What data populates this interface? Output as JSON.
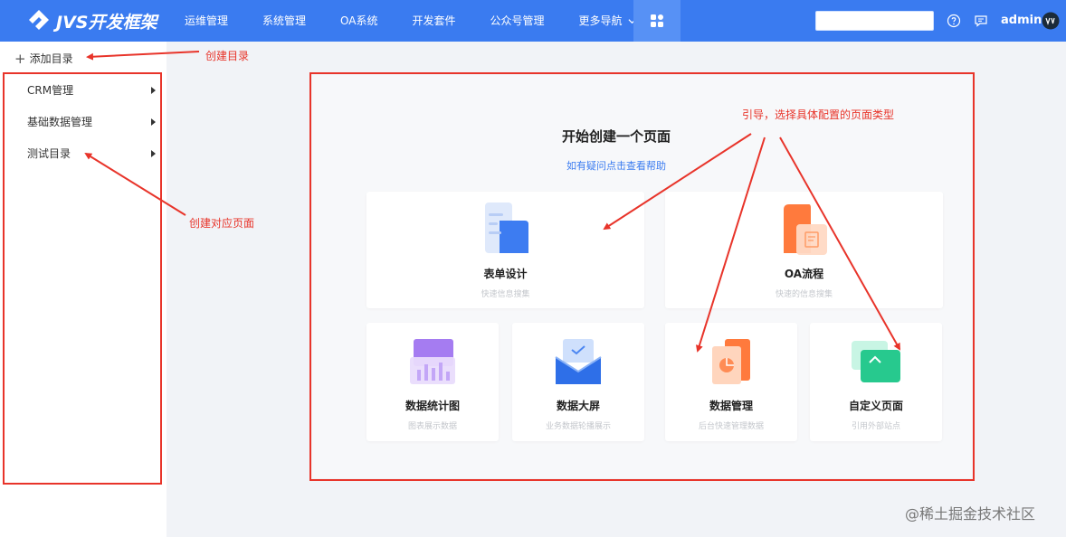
{
  "app": {
    "logo_text": "JVS开发框架"
  },
  "nav": {
    "items": [
      {
        "label": "运维管理"
      },
      {
        "label": "系统管理"
      },
      {
        "label": "OA系统"
      },
      {
        "label": "开发套件"
      },
      {
        "label": "公众号管理"
      },
      {
        "label": "更多导航"
      }
    ],
    "apps_icon": "grid-apps-icon"
  },
  "header": {
    "search_placeholder": "",
    "username": "admin"
  },
  "sidebar": {
    "add_label": "添加目录",
    "items": [
      {
        "label": "CRM管理"
      },
      {
        "label": "基础数据管理"
      },
      {
        "label": "测试目录"
      }
    ]
  },
  "main": {
    "title": "开始创建一个页面",
    "help_link": "如有疑问点击查看帮助",
    "tiles": [
      {
        "name": "表单设计",
        "desc": "快速信息搜集",
        "icon": "form-design-icon"
      },
      {
        "name": "OA流程",
        "desc": "快速的信息搜集",
        "icon": "oa-flow-icon"
      },
      {
        "name": "数据统计图",
        "desc": "图表展示数据",
        "icon": "chart-stat-icon"
      },
      {
        "name": "数据大屏",
        "desc": "业务数据轮播展示",
        "icon": "big-screen-icon"
      },
      {
        "name": "数据管理",
        "desc": "后台快速管理数据",
        "icon": "data-manage-icon"
      },
      {
        "name": "自定义页面",
        "desc": "引用外部站点",
        "icon": "custom-page-icon"
      }
    ]
  },
  "annotations": {
    "create_dir": "创建目录",
    "create_page": "创建对应页面",
    "guide": "引导，选择具体配置的页面类型"
  },
  "watermark": "@稀土掘金技术社区",
  "colors": {
    "primary": "#3a7bf0",
    "annotation": "#e8342a"
  }
}
